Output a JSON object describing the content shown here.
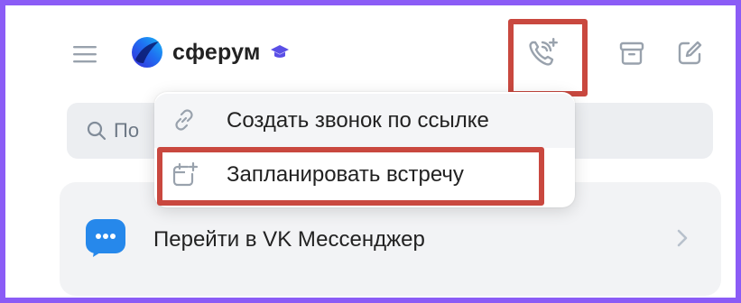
{
  "app": {
    "logo_text": "сферум"
  },
  "toolbar": {
    "menu_icon": "hamburger-icon",
    "call_icon": "phone-plus-icon",
    "archive_icon": "archive-icon",
    "compose_icon": "compose-icon"
  },
  "search": {
    "placeholder_visible": "По"
  },
  "dropdown": {
    "items": [
      {
        "label": "Создать звонок по ссылке",
        "icon": "link-icon"
      },
      {
        "label": "Запланировать встречу",
        "icon": "calendar-plus-icon"
      }
    ]
  },
  "vk_banner": {
    "label": "Перейти в VK Мессенджер",
    "icon": "vk-messenger-icon"
  },
  "colors": {
    "frame_border": "#8b5cf6",
    "highlight": "#c9483f",
    "accent_blue": "#2688eb"
  }
}
